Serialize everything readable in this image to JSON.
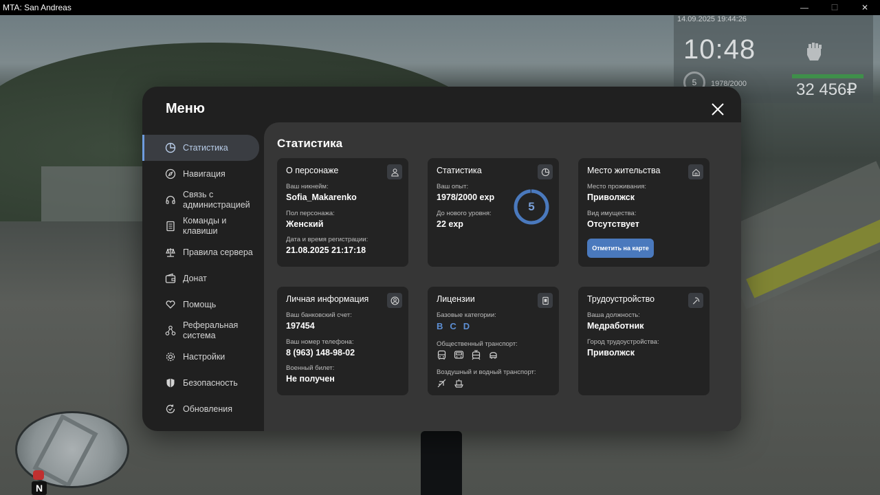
{
  "window": {
    "title": "MTA: San Andreas",
    "minimize": "—",
    "maximize": "☐",
    "close": "✕"
  },
  "hud": {
    "datetime": "14.09.2025 19:44:26",
    "clock": "10:48",
    "level": "5",
    "exp": "1978/2000",
    "money": "32 456₽"
  },
  "menu": {
    "title": "Меню",
    "sidebar": [
      {
        "label": "Статистика",
        "icon": "pie-chart-icon",
        "active": true
      },
      {
        "label": "Навигация",
        "icon": "compass-icon"
      },
      {
        "label": "Связь с\nадминистрацией",
        "icon": "headset-icon"
      },
      {
        "label": "Команды и\nклавиши",
        "icon": "document-icon"
      },
      {
        "label": "Правила сервера",
        "icon": "scales-icon"
      },
      {
        "label": "Донат",
        "icon": "wallet-icon"
      },
      {
        "label": "Помощь",
        "icon": "heart-hands-icon"
      },
      {
        "label": "Реферальная\nсистема",
        "icon": "referral-icon"
      },
      {
        "label": "Настройки",
        "icon": "gear-icon"
      },
      {
        "label": "Безопасность",
        "icon": "shield-icon"
      },
      {
        "label": "Обновления",
        "icon": "refresh-check-icon"
      }
    ],
    "content_title": "Статистика",
    "cards": {
      "character": {
        "title": "О персонаже",
        "icon": "user-icon",
        "nick_label": "Ваш никнейм:",
        "nick": "Sofia_Makarenko",
        "gender_label": "Пол персонажа:",
        "gender": "Женский",
        "reg_label": "Дата и время регистрации:",
        "reg": "21.08.2025 21:17:18"
      },
      "stats": {
        "title": "Статистика",
        "icon": "pie-chart-icon",
        "exp_label": "Ваш опыт:",
        "exp": "1978/2000 exp",
        "next_label": "До нового уровня:",
        "next": "22 exp",
        "level": "5",
        "progress": 0.989
      },
      "residence": {
        "title": "Место жительства",
        "icon": "home-icon",
        "place_label": "Место проживания:",
        "place": "Приволжск",
        "property_label": "Вид имущества:",
        "property": "Отсутствует",
        "map_button": "Отметить на карте"
      },
      "personal": {
        "title": "Личная информация",
        "icon": "user-circle-icon",
        "bank_label": "Ваш банковский счет:",
        "bank": "197454",
        "phone_label": "Ваш номер телефона:",
        "phone": "8 (963) 148-98-02",
        "military_label": "Военный билет:",
        "military": "Не получен"
      },
      "licenses": {
        "title": "Лицензии",
        "icon": "id-card-icon",
        "base_label": "Базовые категории:",
        "categories": [
          "B",
          "C",
          "D"
        ],
        "public_label": "Общественный транспорт:",
        "public_icons": [
          "bus-icon",
          "coach-icon",
          "tram-icon",
          "trolleybus-icon"
        ],
        "air_label": "Воздушный и водный транспорт:",
        "air_icons": [
          "plane-icon",
          "ship-icon"
        ]
      },
      "job": {
        "title": "Трудоустройство",
        "icon": "pickaxe-icon",
        "position_label": "Ваша должность:",
        "position": "Медработник",
        "city_label": "Город трудоустройства:",
        "city": "Приволжск"
      }
    }
  },
  "colors": {
    "accent": "#4a79bd",
    "accent_text": "#5d8fd4",
    "card_bg": "#232323",
    "panel_bg": "#363636",
    "menu_bg": "#202020"
  }
}
